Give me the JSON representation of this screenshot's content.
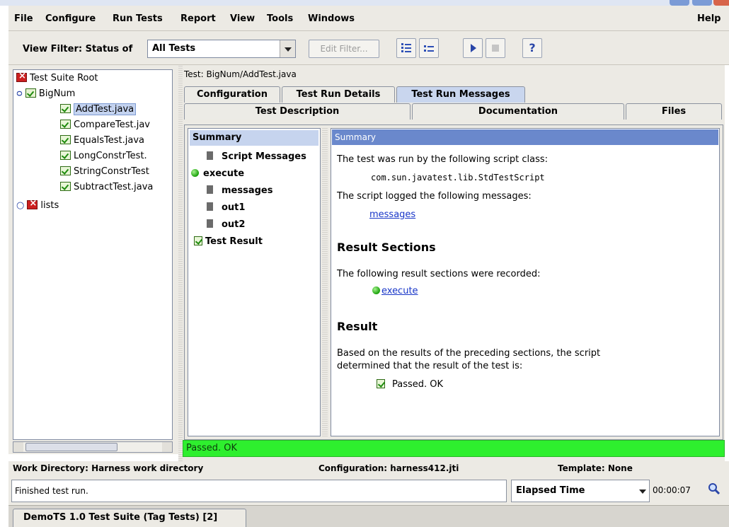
{
  "menubar": {
    "file": "File",
    "configure": "Configure",
    "run_tests": "Run Tests",
    "report": "Report",
    "view": "View",
    "tools": "Tools",
    "windows": "Windows",
    "help": "Help"
  },
  "toolbar": {
    "view_filter_label": "View Filter: Status of",
    "view_filter_value": "All Tests",
    "edit_filter_label": "Edit Filter...",
    "help_label": "?"
  },
  "tree": {
    "root": "Test Suite Root",
    "group": "BigNum",
    "items": [
      "AddTest.java",
      "CompareTest.jav",
      "EqualsTest.java",
      "LongConstrTest.",
      "StringConstrTest",
      "SubtractTest.java"
    ],
    "lists": "lists"
  },
  "test_panel": {
    "path": "Test: BigNum/AddTest.java",
    "tabs_top": [
      "Configuration",
      "Test Run Details",
      "Test Run Messages"
    ],
    "tabs_bottom": [
      "Test Description",
      "Documentation",
      "Files"
    ]
  },
  "summary_list": {
    "header": "Summary",
    "items": [
      "Script Messages",
      "execute",
      "messages",
      "out1",
      "out2",
      "Test Result"
    ]
  },
  "detail": {
    "header": "Summary",
    "run_by": "The test was run by the following script class:",
    "script_class": "com.sun.javatest.lib.StdTestScript",
    "logged": "The script logged the following messages:",
    "messages_link": "messages",
    "result_sections_title": "Result Sections",
    "recorded": "The following result sections were recorded:",
    "execute_link": "execute",
    "result_title": "Result",
    "result_text_1": "Based on the results of the preceding sections, the script",
    "result_text_2": "determined that the result of the test is:",
    "result_value": "Passed. OK"
  },
  "status": {
    "text": "Passed. OK"
  },
  "info": {
    "work_dir": "Work Directory: Harness work directory",
    "configuration": "Configuration: harness412.jti",
    "template": "Template: None"
  },
  "bottom": {
    "message": "Finished test run.",
    "elapsed_label": "Elapsed Time",
    "elapsed_value": "00:00:07"
  },
  "suite_tab": {
    "label": "DemoTS 1.0 Test Suite (Tag Tests) [2]"
  }
}
